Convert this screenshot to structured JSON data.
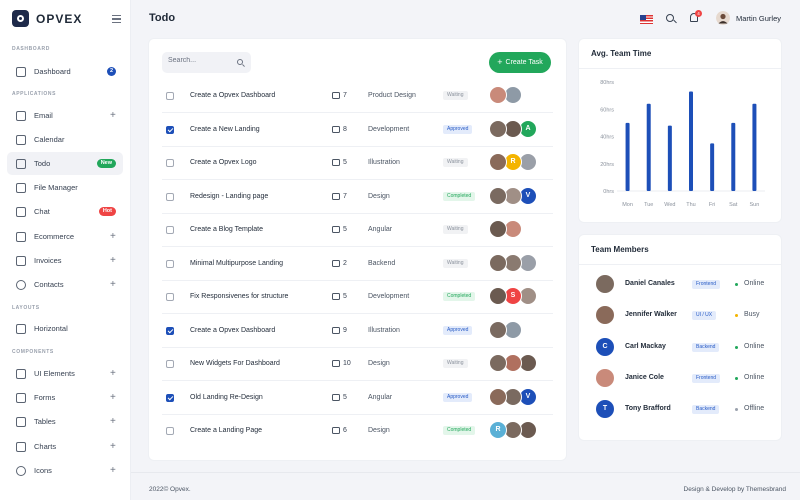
{
  "brand": {
    "name": "OPVEX"
  },
  "sidebar": {
    "sections": {
      "dashboard": "DASHBOARD",
      "applications": "APPLICATIONS",
      "layouts": "LAYOUTS",
      "components": "COMPONENTS"
    },
    "items": [
      {
        "key": "dashboard",
        "label": "Dashboard",
        "icon": "home-icon",
        "badge": "2",
        "badge_color": "#1d4fb8"
      },
      {
        "key": "email",
        "label": "Email",
        "icon": "mail-icon",
        "plus": "+"
      },
      {
        "key": "calendar",
        "label": "Calendar",
        "icon": "calendar-icon"
      },
      {
        "key": "todo",
        "label": "Todo",
        "icon": "checkbox-icon",
        "badge": "New",
        "badge_color": "#22a75b",
        "active": true
      },
      {
        "key": "file-manager",
        "label": "File Manager",
        "icon": "file-icon"
      },
      {
        "key": "chat",
        "label": "Chat",
        "icon": "chat-icon",
        "badge": "Hot",
        "badge_color": "#ef4444"
      },
      {
        "key": "ecommerce",
        "label": "Ecommerce",
        "icon": "store-icon",
        "plus": "+"
      },
      {
        "key": "invoices",
        "label": "Invoices",
        "icon": "invoice-icon",
        "plus": "+"
      },
      {
        "key": "contacts",
        "label": "Contacts",
        "icon": "contacts-icon",
        "plus": "+"
      },
      {
        "key": "horizontal",
        "label": "Horizontal",
        "icon": "layout-icon"
      },
      {
        "key": "ui-elements",
        "label": "UI Elements",
        "icon": "cube-icon",
        "plus": "+"
      },
      {
        "key": "forms",
        "label": "Forms",
        "icon": "forms-icon",
        "plus": "+"
      },
      {
        "key": "tables",
        "label": "Tables",
        "icon": "table-icon",
        "plus": "+"
      },
      {
        "key": "charts",
        "label": "Charts",
        "icon": "chart-icon",
        "plus": "+"
      },
      {
        "key": "icons",
        "label": "Icons",
        "icon": "leaf-icon",
        "plus": "+"
      }
    ]
  },
  "header": {
    "title": "Todo",
    "notification_count": "4",
    "user_name": "Martin Gurley"
  },
  "todo": {
    "search_placeholder": "Search...",
    "create_label": "Create Task",
    "tasks": [
      {
        "name": "Create a Opvex Dashboard",
        "comments": "7",
        "category": "Product Design",
        "status": "Waiting",
        "checked": false,
        "avatars": [
          {
            "c": "#c98a7a"
          },
          {
            "c": "#8e9aa6"
          }
        ]
      },
      {
        "name": "Create a New Landing",
        "comments": "8",
        "category": "Development",
        "status": "Approved",
        "checked": true,
        "avatars": [
          {
            "c": "#7b6a5f"
          },
          {
            "c": "#6b5a50"
          },
          {
            "c": "#22a75b",
            "t": "A"
          }
        ]
      },
      {
        "name": "Create a Opvex Logo",
        "comments": "5",
        "category": "Illustration",
        "status": "Waiting",
        "checked": false,
        "avatars": [
          {
            "c": "#8a6a5a"
          },
          {
            "c": "#f4b400",
            "t": "R"
          },
          {
            "c": "#9a9fa8"
          }
        ]
      },
      {
        "name": "Redesign - Landing page",
        "comments": "7",
        "category": "Design",
        "status": "Completed",
        "checked": false,
        "avatars": [
          {
            "c": "#7a6a60"
          },
          {
            "c": "#a08f86"
          },
          {
            "c": "#1d4fb8",
            "t": "V"
          }
        ]
      },
      {
        "name": "Create a Blog Template",
        "comments": "5",
        "category": "Angular",
        "status": "Waiting",
        "checked": false,
        "avatars": [
          {
            "c": "#6b5a50"
          },
          {
            "c": "#c98a7a"
          }
        ]
      },
      {
        "name": "Minimal Multipurpose Landing",
        "comments": "2",
        "category": "Backend",
        "status": "Waiting",
        "checked": false,
        "avatars": [
          {
            "c": "#7b6a5f"
          },
          {
            "c": "#8a7a70"
          },
          {
            "c": "#9a9fa8"
          }
        ]
      },
      {
        "name": "Fix Responsivenes for structure",
        "comments": "5",
        "category": "Development",
        "status": "Completed",
        "checked": false,
        "avatars": [
          {
            "c": "#6b5a50"
          },
          {
            "c": "#ef4444",
            "t": "S"
          },
          {
            "c": "#a08f86"
          }
        ]
      },
      {
        "name": "Create a Opvex Dashboard",
        "comments": "9",
        "category": "Illustration",
        "status": "Approved",
        "checked": true,
        "avatars": [
          {
            "c": "#7a6a60"
          },
          {
            "c": "#8e9aa6"
          }
        ]
      },
      {
        "name": "New Widgets For Dashboard",
        "comments": "10",
        "category": "Design",
        "status": "Waiting",
        "checked": false,
        "avatars": [
          {
            "c": "#7b6a5f"
          },
          {
            "c": "#b0705f"
          },
          {
            "c": "#6b5a50"
          }
        ]
      },
      {
        "name": "Old Landing Re-Design",
        "comments": "5",
        "category": "Angular",
        "status": "Approved",
        "checked": true,
        "avatars": [
          {
            "c": "#8a6a5a"
          },
          {
            "c": "#7a6a60"
          },
          {
            "c": "#1d4fb8",
            "t": "V"
          }
        ]
      },
      {
        "name": "Create a Landing Page",
        "comments": "6",
        "category": "Design",
        "status": "Completed",
        "checked": false,
        "avatars": [
          {
            "c": "#5ab0d6",
            "t": "R"
          },
          {
            "c": "#7b6a5f"
          },
          {
            "c": "#6b5a50"
          }
        ]
      }
    ]
  },
  "chart_data": {
    "type": "bar",
    "title": "Avg. Team Time",
    "categories": [
      "Mon",
      "Tue",
      "Wed",
      "Thu",
      "Fri",
      "Sat",
      "Sun"
    ],
    "values": [
      50,
      64,
      48,
      73,
      35,
      50,
      64
    ],
    "ylim": [
      0,
      80
    ],
    "yticks": [
      "0hrs",
      "20hrs",
      "40hrs",
      "60hrs",
      "80hrs"
    ],
    "bar_color": "#1d4fb8",
    "grid": false
  },
  "team": {
    "title": "Team Members",
    "members": [
      {
        "name": "Daniel Canales",
        "role": "Frontend",
        "status": "Online",
        "status_color": "#22a75b",
        "avatar_color": "#7b6a5f",
        "initial": ""
      },
      {
        "name": "Jennifer Walker",
        "role": "UI / UX",
        "status": "Busy",
        "status_color": "#f4b400",
        "avatar_color": "#8a6a5a",
        "initial": ""
      },
      {
        "name": "Carl Mackay",
        "role": "Backend",
        "status": "Online",
        "status_color": "#22a75b",
        "avatar_color": "#1d4fb8",
        "initial": "C"
      },
      {
        "name": "Janice Cole",
        "role": "Frontend",
        "status": "Online",
        "status_color": "#22a75b",
        "avatar_color": "#c98a7a",
        "initial": ""
      },
      {
        "name": "Tony Brafford",
        "role": "Backend",
        "status": "Offline",
        "status_color": "#9aa1ad",
        "avatar_color": "#1d4fb8",
        "initial": "T"
      }
    ]
  },
  "footer": {
    "copyright": "2022© Opvex.",
    "credit": "Design & Develop by Themesbrand"
  }
}
